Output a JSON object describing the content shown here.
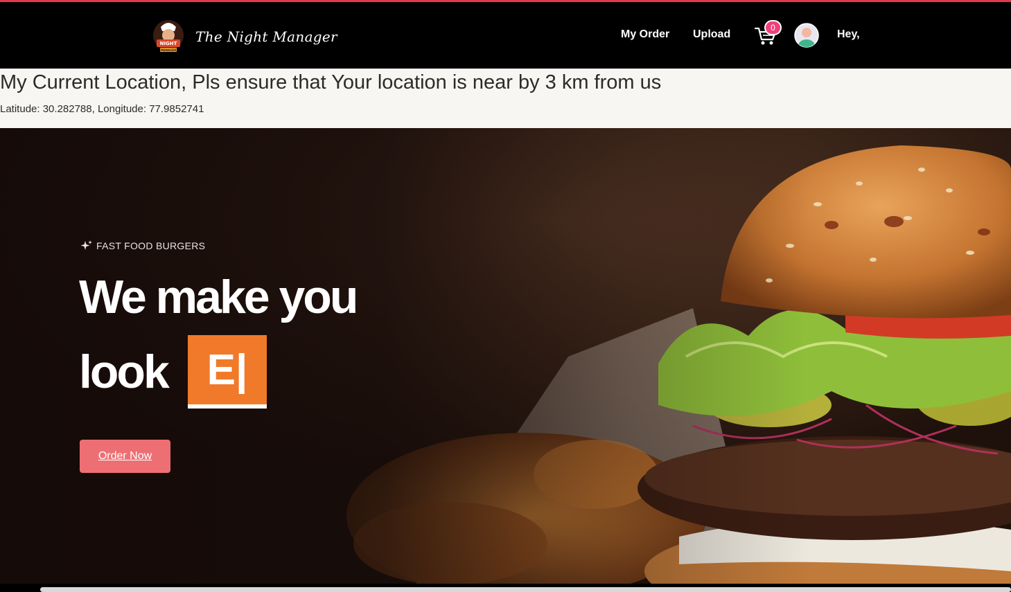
{
  "colors": {
    "accent_top": "#e0394a",
    "navbar_bg": "#000000",
    "badge": "#f0407a",
    "highlight_box": "#f07a2a",
    "order_button": "#ee6f73",
    "location_bg": "#f8f6f2"
  },
  "navbar": {
    "logo_icon": "night-manager-logo",
    "brand": "The Night Manager",
    "links": {
      "my_order": "My Order",
      "upload": "Upload"
    },
    "cart_icon": "cart-icon",
    "cart_count": "0",
    "avatar_icon": "user-avatar-icon",
    "greeting": "Hey,"
  },
  "location": {
    "title": "My Current Location, Pls ensure that Your location is near by 3 km from us",
    "coords": "Latitude: 30.282788, Longitude: 77.9852741"
  },
  "hero": {
    "tagline_icon": "sparkle-icon",
    "tagline": "FAST FOOD BURGERS",
    "headline_line1": "We make you",
    "headline_line2": "look",
    "typed_text": "E|",
    "cta": "Order Now"
  }
}
